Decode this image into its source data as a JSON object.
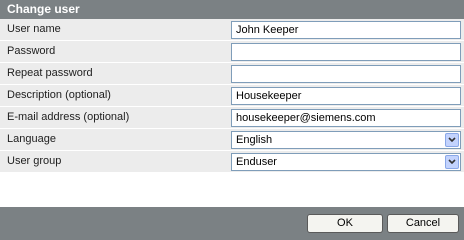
{
  "dialog": {
    "title": "Change user"
  },
  "fields": {
    "username": {
      "label": "User name",
      "value": "John Keeper"
    },
    "password": {
      "label": "Password",
      "value": ""
    },
    "repeat_password": {
      "label": "Repeat password",
      "value": ""
    },
    "description": {
      "label": "Description (optional)",
      "value": "Housekeeper"
    },
    "email": {
      "label": "E-mail address (optional)",
      "value": "housekeeper@siemens.com"
    },
    "language": {
      "label": "Language",
      "selected": "English",
      "icon": "chevron-down-icon"
    },
    "user_group": {
      "label": "User group",
      "selected": "Enduser",
      "icon": "chevron-down-icon"
    }
  },
  "buttons": {
    "ok_label": "OK",
    "cancel_label": "Cancel"
  },
  "colors": {
    "title_bar": "#7b8184",
    "row_background": "#ececec",
    "input_border": "#7f9db9",
    "dropdown_button": "#c3d3fd"
  }
}
